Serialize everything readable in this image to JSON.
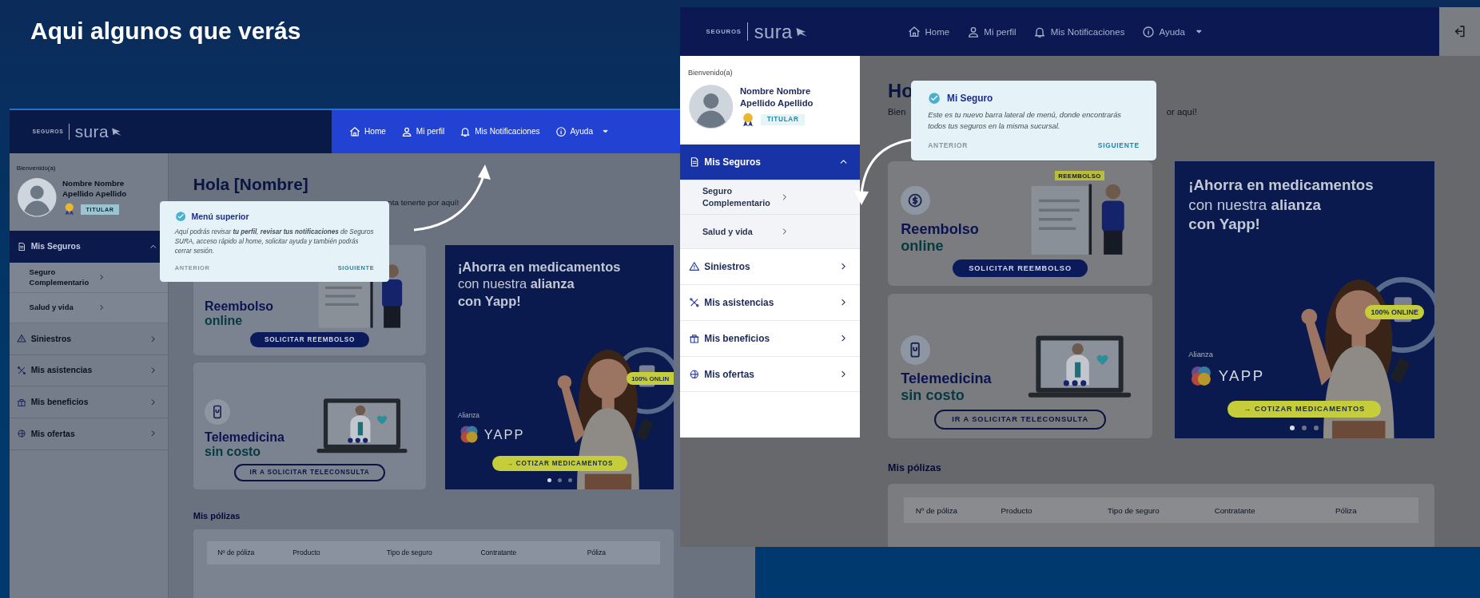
{
  "title": "Aqui algunos que verás",
  "screens": [
    {
      "logout": false,
      "logo": {
        "small": "SEGUROS",
        "brand": "sura"
      },
      "nav": {
        "highlighted": true,
        "items": [
          {
            "label": "Home",
            "dropdown": false
          },
          {
            "label": "Mi perfil",
            "dropdown": false
          },
          {
            "label": "Mis Notificaciones",
            "dropdown": false
          },
          {
            "label": "Ayuda",
            "dropdown": true
          }
        ]
      },
      "sidebar": {
        "highlighted": false,
        "welcome": "Bienvenido(a)",
        "user_name": "Nombre Nombre Apellido Apellido",
        "role": "TITULAR",
        "menu": [
          {
            "label": "Mis Seguros",
            "selected": true,
            "expanded": true,
            "children": [
              {
                "label": "Seguro Complementario",
                "selected": false
              },
              {
                "label": "Salud y vida",
                "selected": false
              }
            ]
          },
          {
            "label": "Siniestros",
            "selected": false,
            "expanded": false
          },
          {
            "label": "Mis asistencias",
            "selected": false,
            "expanded": false
          },
          {
            "label": "Mis beneficios",
            "selected": false,
            "expanded": false
          },
          {
            "label": "Mis ofertas",
            "selected": false,
            "expanded": false
          }
        ]
      },
      "greeting": "Hola [Nombre]",
      "subtitle_after": "nta tenerte por aquí!",
      "cards": [
        {
          "kind": "refund",
          "icon": false,
          "title": "Reembolso",
          "subtitle": "online",
          "button": "SOLICITAR REEMBOLSO"
        },
        {
          "kind": "telemedicine",
          "icon": true,
          "title": "Telemedicina",
          "subtitle": "sin costo",
          "button": "IR A SOLICITAR TELECONSULTA"
        }
      ],
      "banner": {
        "headline": [
          "¡Ahorra en medicamentos",
          "con nuestra **alianza**",
          "con **Yapp!**"
        ],
        "partner_label": "Alianza",
        "partner_logo": "YAPP",
        "badge": "100% ONLIN",
        "button": "→ COTIZAR MEDICAMENTOS",
        "dots": [
          {
            "selected": true
          },
          {
            "selected": false
          },
          {
            "selected": false
          }
        ]
      },
      "policies": {
        "title": "Mis pólizas",
        "columns": [
          "Nº de póliza",
          "Producto",
          "Tipo de seguro",
          "Contratante",
          "Póliza"
        ]
      },
      "tooltip": {
        "title": "Menú superior",
        "text": "Aquí podrás revisar **tu perfil**, **revisar tus notificaciones** de Seguros SURA, acceso rápido al home, solicitar ayuda y también podrás cerrar sesión.",
        "buttons": [
          {
            "label": "ANTERIOR",
            "disabled": true
          },
          {
            "label": "SIGUIENTE",
            "disabled": false
          }
        ]
      }
    },
    {
      "logout": true,
      "logo": {
        "small": "SEGUROS",
        "brand": "sura"
      },
      "nav": {
        "highlighted": false,
        "items": [
          {
            "label": "Home",
            "dropdown": false
          },
          {
            "label": "Mi perfil",
            "dropdown": false
          },
          {
            "label": "Mis Notificaciones",
            "dropdown": false
          },
          {
            "label": "Ayuda",
            "dropdown": true
          }
        ]
      },
      "sidebar": {
        "highlighted": true,
        "welcome": "Bienvenido(a)",
        "user_name": "Nombre Nombre Apellido Apellido",
        "role": "TITULAR",
        "menu": [
          {
            "label": "Mis Seguros",
            "selected": true,
            "expanded": true,
            "children": [
              {
                "label": "Seguro Complementario",
                "selected": false
              },
              {
                "label": "Salud y vida",
                "selected": false
              }
            ]
          },
          {
            "label": "Siniestros",
            "selected": false,
            "expanded": false
          },
          {
            "label": "Mis asistencias",
            "selected": false,
            "expanded": false
          },
          {
            "label": "Mis beneficios",
            "selected": false,
            "expanded": false
          },
          {
            "label": "Mis ofertas",
            "selected": false,
            "expanded": false
          }
        ]
      },
      "greeting": "Ho",
      "subtitle_before": "Bien",
      "subtitle_after": "or aquí!",
      "cards": [
        {
          "kind": "refund",
          "icon": true,
          "tag": "REEMBOLSO",
          "title": "Reembolso",
          "subtitle": "online",
          "button": "SOLICITAR REEMBOLSO"
        },
        {
          "kind": "telemedicine",
          "icon": true,
          "title": "Telemedicina",
          "subtitle": "sin costo",
          "button": "IR A SOLICITAR TELECONSULTA"
        }
      ],
      "banner": {
        "headline": [
          "¡Ahorra en medicamentos",
          "con nuestra **alianza**",
          "con **Yapp!**"
        ],
        "partner_label": "Alianza",
        "partner_logo": "YAPP",
        "badge": "100% ONLINE",
        "button": "→ COTIZAR MEDICAMENTOS",
        "dots": [
          {
            "selected": true
          },
          {
            "selected": false
          },
          {
            "selected": false
          }
        ]
      },
      "policies": {
        "title": "Mis pólizas",
        "columns": [
          "Nº de póliza",
          "Producto",
          "Tipo de seguro",
          "Contratante",
          "Póliza"
        ]
      },
      "tooltip": {
        "title": "Mi Seguro",
        "text": "Este es tu nuevo barra lateral de menú, donde encontrarás todos tus seguros en la misma sucursal.",
        "buttons": [
          {
            "label": "ANTERIOR",
            "disabled": true
          },
          {
            "label": "SIGUIENTE",
            "disabled": false
          }
        ]
      }
    }
  ]
}
